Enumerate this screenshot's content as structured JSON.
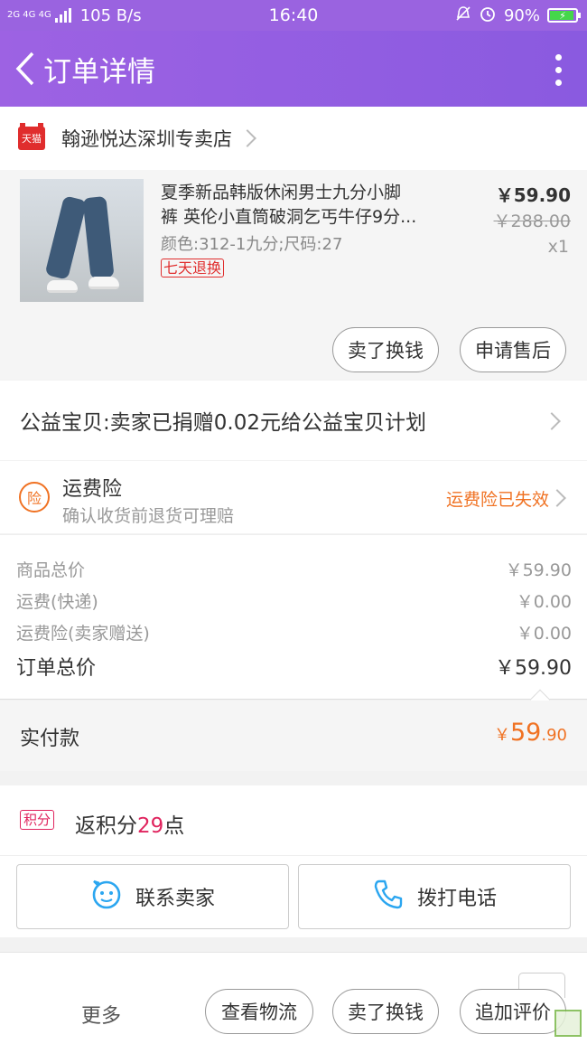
{
  "status_bar": {
    "network": "2G 4G 4G",
    "speed": "105 B/s",
    "time": "16:40",
    "battery": "90%"
  },
  "header": {
    "title": "订单详情"
  },
  "store": {
    "badge": "天猫",
    "name": "翰逊悦达深圳专卖店"
  },
  "product": {
    "title_line1": "夏季新品韩版休闲男士九分小脚",
    "title_line2": "裤 英伦小直筒破洞乞丐牛仔9分...",
    "spec": "颜色:312-1九分;尺码:27",
    "badge": "七天退换",
    "price": "￥59.90",
    "original_price": "￥288.00",
    "quantity": "x1",
    "buttons": {
      "sell": "卖了换钱",
      "after_sale": "申请售后"
    }
  },
  "charity": {
    "text": "公益宝贝:卖家已捐赠0.02元给公益宝贝计划"
  },
  "insurance": {
    "icon_text": "险",
    "title": "运费险",
    "subtitle": "确认收货前退货可理赔",
    "status": "运费险已失效"
  },
  "totals": {
    "rows": [
      {
        "label": "商品总价",
        "value": "￥59.90"
      },
      {
        "label": "运费(快递)",
        "value": "￥0.00"
      },
      {
        "label": "运费险(卖家赠送)",
        "value": "￥0.00"
      }
    ],
    "order_total_label": "订单总价",
    "order_total_value": "￥59.90"
  },
  "paid": {
    "label": "实付款",
    "currency": "￥",
    "integer": "59",
    "decimal": ".90"
  },
  "points": {
    "icon_text": "积分",
    "prefix": "返积分",
    "count": "29",
    "suffix": "点"
  },
  "contact": {
    "seller": "联系卖家",
    "phone": "拨打电话"
  },
  "bottom_bar": {
    "more": "更多",
    "track": "查看物流",
    "sell": "卖了换钱",
    "review": "追加评价"
  },
  "colors": {
    "header": "#9a63e0",
    "accent_orange": "#f07223",
    "accent_red": "#e02d2d",
    "points_pink": "#e0245e"
  }
}
